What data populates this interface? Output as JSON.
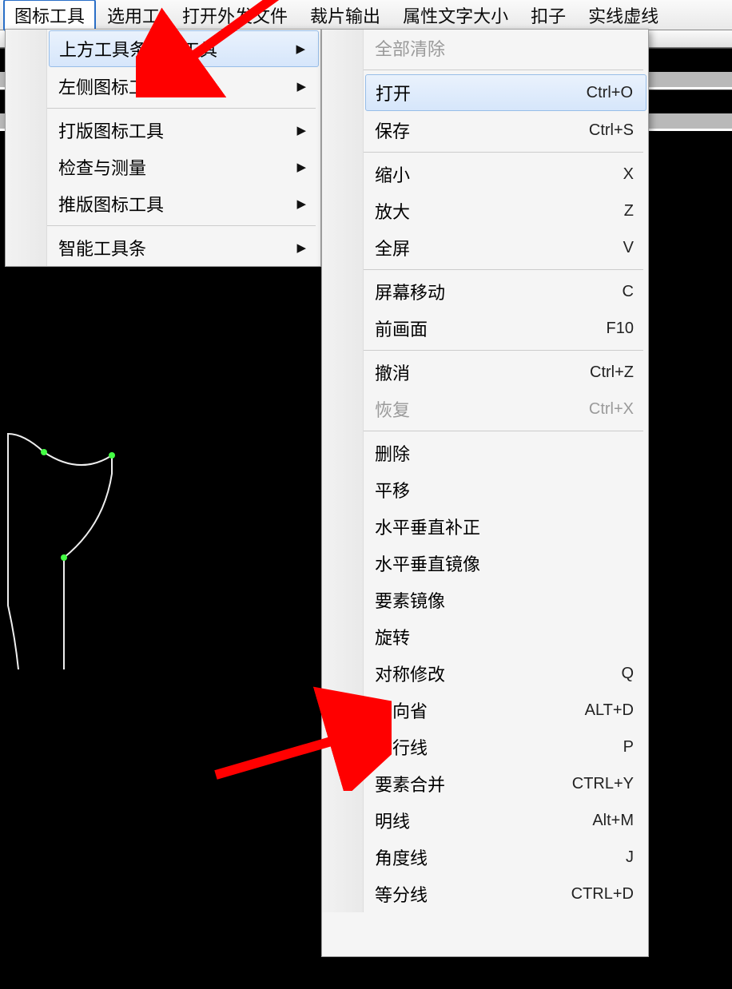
{
  "menubar": {
    "items": [
      "图标工具",
      "选用工",
      "打开外发文件",
      "裁片输出",
      "属性文字大小",
      "扣子",
      "实线虚线"
    ],
    "active_index": 0
  },
  "submenu1": {
    "highlighted_index": 0,
    "groups": [
      [
        {
          "label": "上方工具条图标工具",
          "arrow": true
        },
        {
          "label": "左侧图标工具",
          "arrow": true
        }
      ],
      [
        {
          "label": "打版图标工具",
          "arrow": true
        },
        {
          "label": "检查与测量",
          "arrow": true
        },
        {
          "label": "推版图标工具",
          "arrow": true
        }
      ],
      [
        {
          "label": "智能工具条",
          "arrow": true
        }
      ]
    ]
  },
  "submenu2": {
    "highlighted_index": 1,
    "groups": [
      [
        {
          "label": "全部清除",
          "shortcut": "",
          "disabled": true
        }
      ],
      [
        {
          "label": "打开",
          "shortcut": "Ctrl+O"
        },
        {
          "label": "保存",
          "shortcut": "Ctrl+S"
        }
      ],
      [
        {
          "label": "缩小",
          "shortcut": "X"
        },
        {
          "label": "放大",
          "shortcut": "Z"
        },
        {
          "label": "全屏",
          "shortcut": "V"
        }
      ],
      [
        {
          "label": "屏幕移动",
          "shortcut": "C"
        },
        {
          "label": "前画面",
          "shortcut": "F10"
        }
      ],
      [
        {
          "label": "撤消",
          "shortcut": "Ctrl+Z"
        },
        {
          "label": "恢复",
          "shortcut": "Ctrl+X",
          "disabled": true
        }
      ],
      [
        {
          "label": "删除",
          "shortcut": ""
        },
        {
          "label": "平移",
          "shortcut": ""
        },
        {
          "label": "水平垂直补正",
          "shortcut": ""
        },
        {
          "label": "水平垂直镜像",
          "shortcut": ""
        },
        {
          "label": "要素镜像",
          "shortcut": ""
        },
        {
          "label": "旋转",
          "shortcut": ""
        },
        {
          "label": "对称修改",
          "shortcut": "Q"
        },
        {
          "label": "单向省",
          "shortcut": "ALT+D"
        },
        {
          "label": "平行线",
          "shortcut": "P"
        },
        {
          "label": "要素合并",
          "shortcut": "CTRL+Y"
        },
        {
          "label": "明线",
          "shortcut": "Alt+M"
        },
        {
          "label": "角度线",
          "shortcut": "J"
        },
        {
          "label": "等分线",
          "shortcut": "CTRL+D"
        }
      ]
    ]
  }
}
